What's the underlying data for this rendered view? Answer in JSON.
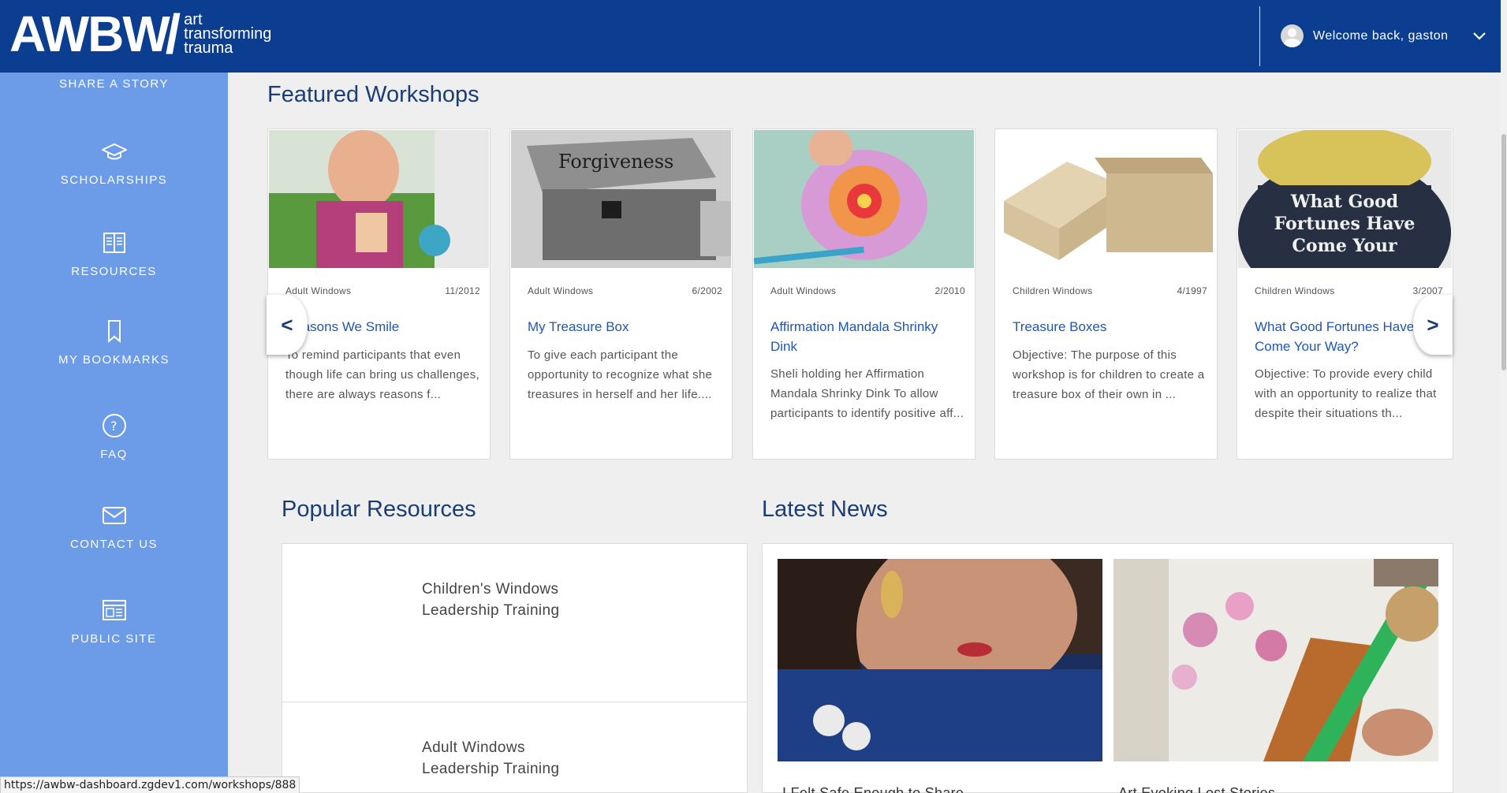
{
  "header": {
    "logo_main": "AWBW",
    "logo_sub": [
      "art",
      "transforming",
      "trauma"
    ],
    "welcome": "Welcome back, gaston"
  },
  "sidebar": {
    "items": [
      {
        "label": "SHARE A STORY",
        "icon": "share-story-icon"
      },
      {
        "label": "SCHOLARSHIPS",
        "icon": "graduation-cap-icon"
      },
      {
        "label": "RESOURCES",
        "icon": "book-icon"
      },
      {
        "label": "MY BOOKMARKS",
        "icon": "bookmark-icon"
      },
      {
        "label": "FAQ",
        "icon": "question-icon"
      },
      {
        "label": "CONTACT US",
        "icon": "envelope-icon"
      },
      {
        "label": "PUBLIC SITE",
        "icon": "browser-icon"
      }
    ]
  },
  "featured": {
    "title": "Featured Workshops",
    "prev": "<",
    "next": ">",
    "cards": [
      {
        "category": "Adult Windows",
        "date": "11/2012",
        "title": "Reasons We Smile",
        "desc": "To remind participants that even though life can bring us challenges, there are always reasons f..."
      },
      {
        "category": "Adult Windows",
        "date": "6/2002",
        "title": "My Treasure Box",
        "desc": "To give each participant the opportunity to recognize what she treasures in herself and her life...."
      },
      {
        "category": "Adult Windows",
        "date": "2/2010",
        "title": "Affirmation Mandala Shrinky Dink",
        "desc": "Sheli holding her Affirmation Mandala Shrinky Dink To allow participants to identify positive aff..."
      },
      {
        "category": "Children Windows",
        "date": "4/1997",
        "title": "Treasure Boxes",
        "desc": "Objective: The purpose of this workshop is for children to create a treasure box of their own in ..."
      },
      {
        "category": "Children Windows",
        "date": "3/2007",
        "title": "What Good Fortunes Have Come Your Way?",
        "desc": "Objective: To provide every child with an opportunity to realize that despite their situations th...",
        "image_text": "What Good Fortunes Have Come Your"
      }
    ]
  },
  "resources": {
    "title": "Popular Resources",
    "items": [
      {
        "title": "Children's Windows Leadership Training"
      },
      {
        "title": "Adult Windows Leadership Training"
      }
    ]
  },
  "news": {
    "title": "Latest News",
    "items": [
      {
        "title": "I Felt Safe Enough to Share"
      },
      {
        "title": "Art Evoking Lost Stories"
      }
    ]
  },
  "status_url": "https://awbw-dashboard.zgdev1.com/workshops/888",
  "colors": {
    "header": "#0b3d91",
    "sidebar": "#6c9be8",
    "title": "#1a3d78",
    "link": "#1f56b3"
  }
}
